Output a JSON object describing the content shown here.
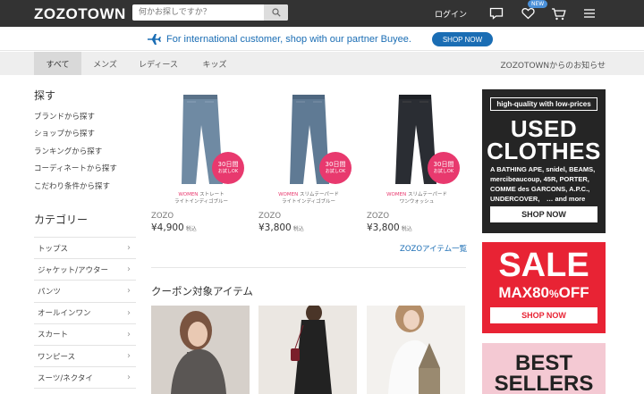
{
  "header": {
    "logo": "ZOZOTOWN",
    "search_placeholder": "何かお探しですか？",
    "login": "ログイン",
    "new_badge": "NEW"
  },
  "banner": {
    "text": "For international customer, shop with our partner Buyee.",
    "button": "SHOP NOW"
  },
  "tabs": [
    {
      "label": "すべて",
      "active": true
    },
    {
      "label": "メンズ",
      "active": false
    },
    {
      "label": "レディース",
      "active": false
    },
    {
      "label": "キッズ",
      "active": false
    }
  ],
  "notice": "ZOZOTOWNからのお知らせ",
  "sidebar": {
    "explore_title": "探す",
    "explore_links": [
      "ブランドから探す",
      "ショップから探す",
      "ランキングから探す",
      "コーディネートから探す",
      "こだわり条件から探す"
    ],
    "category_title": "カテゴリー",
    "categories": [
      "トップス",
      "ジャケット/アウター",
      "パンツ",
      "オールインワン",
      "スカート",
      "ワンピース",
      "スーツ/ネクタイ"
    ]
  },
  "products": [
    {
      "badge_main": "30日間",
      "badge_sub": "お試しOK",
      "gender": "WOMEN",
      "name1": "ストレート",
      "name2": "ライトインディゴブルー",
      "brand": "ZOZO",
      "price": "¥4,900",
      "tax": "税込",
      "denim_color": "#6f8aa3"
    },
    {
      "badge_main": "30日間",
      "badge_sub": "お試しOK",
      "gender": "WOMEN",
      "name1": "スリムテーパード",
      "name2": "ライトインディゴブルー",
      "brand": "ZOZO",
      "price": "¥3,800",
      "tax": "税込",
      "denim_color": "#5f7a94"
    },
    {
      "badge_main": "30日間",
      "badge_sub": "お試しOK",
      "gender": "WOMEN",
      "name1": "スリムテーパード",
      "name2": "ワンウォッシュ",
      "brand": "ZOZO",
      "price": "¥3,800",
      "tax": "税込",
      "denim_color": "#2a2d33"
    }
  ],
  "zozo_link": "ZOZOアイテム一覧",
  "coupon_title": "クーポン対象アイテム",
  "ads": {
    "used": {
      "tag": "high-quality with low-prices",
      "line1": "USED",
      "line2": "CLOTHES",
      "brands": "A BATHING APE, snidel, BEAMS, mercibeaucoup, 45R, PORTER, COMME des GARCONS, A.P.C., UNDERCOVER,　… and more",
      "button": "SHOP NOW"
    },
    "sale": {
      "line1": "SALE",
      "max": "MAX80",
      "pct": "%",
      "off": "OFF",
      "button": "SHOP NOW"
    },
    "best": {
      "line1": "BEST",
      "line2": "SELLERS"
    }
  },
  "colors": {
    "header_bg": "#333333",
    "accent_blue": "#1a6db4",
    "badge_pink": "#e8396e",
    "sale_red": "#e82334"
  }
}
